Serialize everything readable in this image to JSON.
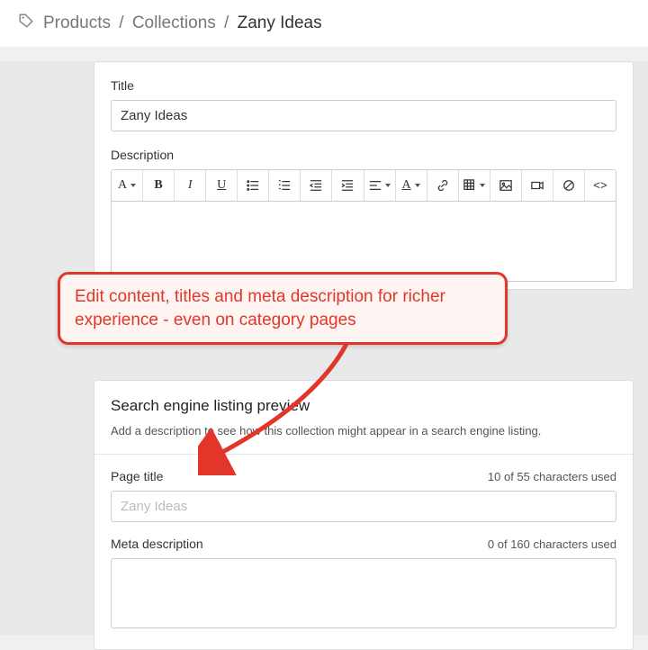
{
  "breadcrumb": {
    "parts": [
      "Products",
      "Collections"
    ],
    "current": "Zany Ideas"
  },
  "form": {
    "title_label": "Title",
    "title_value": "Zany Ideas",
    "description_label": "Description"
  },
  "toolbar": {
    "font_label": "A",
    "bold": "B",
    "italic": "I",
    "underline": "U",
    "color_label": "A"
  },
  "seo": {
    "heading": "Search engine listing preview",
    "subtext": "Add a description to see how this collection might appear in a search engine listing.",
    "page_title_label": "Page title",
    "page_title_chars": "10 of 55 characters used",
    "page_title_placeholder": "Zany Ideas",
    "meta_label": "Meta description",
    "meta_chars": "0 of 160 characters used"
  },
  "annotation": {
    "text": "Edit content, titles and meta description for richer experience - even on category pages"
  }
}
